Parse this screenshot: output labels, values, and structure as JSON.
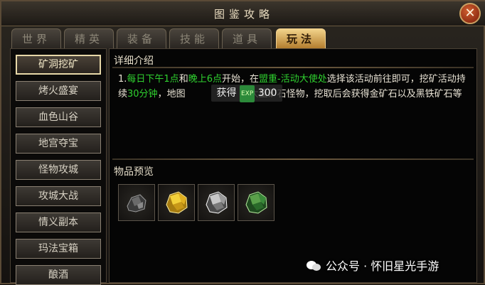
{
  "window": {
    "title": "图鉴攻略",
    "close_label": "✕"
  },
  "tabs": [
    {
      "label": "世界",
      "active": false
    },
    {
      "label": "精英",
      "active": false
    },
    {
      "label": "装备",
      "active": false
    },
    {
      "label": "技能",
      "active": false
    },
    {
      "label": "道具",
      "active": false
    },
    {
      "label": "玩法",
      "active": true
    }
  ],
  "sidebar": {
    "items": [
      {
        "label": "矿洞挖矿",
        "active": true
      },
      {
        "label": "烤火盛宴",
        "active": false
      },
      {
        "label": "血色山谷",
        "active": false
      },
      {
        "label": "地宫夺宝",
        "active": false
      },
      {
        "label": "怪物攻城",
        "active": false
      },
      {
        "label": "攻城大战",
        "active": false
      },
      {
        "label": "情义副本",
        "active": false
      },
      {
        "label": "玛法宝箱",
        "active": false
      },
      {
        "label": "酿酒",
        "active": false
      }
    ]
  },
  "detail": {
    "heading": "详细介绍",
    "text_parts": {
      "p1": "1.",
      "p2": "每日下午1点",
      "p3": "和",
      "p4": "晚上6点",
      "p5": "开始，在",
      "p6": "盟重-活动大使处",
      "p7": "选择该活动前往即可，挖矿活动持续",
      "p8": "30分钟",
      "p9": "，地图",
      "p10": "大量矿石怪物，挖取后会获得金矿石以及黑铁矿石等"
    },
    "toast": {
      "text": "获得",
      "icon": "exp-icon",
      "value": "300"
    }
  },
  "preview": {
    "heading": "物品预览",
    "items": [
      {
        "name": "black-iron-ore-icon",
        "color": "#7a7a7a"
      },
      {
        "name": "gold-ore-icon",
        "color": "#e0b020"
      },
      {
        "name": "silver-ore-icon",
        "color": "#c8c8c8"
      },
      {
        "name": "green-ore-icon",
        "color": "#3a8a3a"
      }
    ]
  },
  "watermark": {
    "text": "公众号 · 怀旧星光手游"
  }
}
